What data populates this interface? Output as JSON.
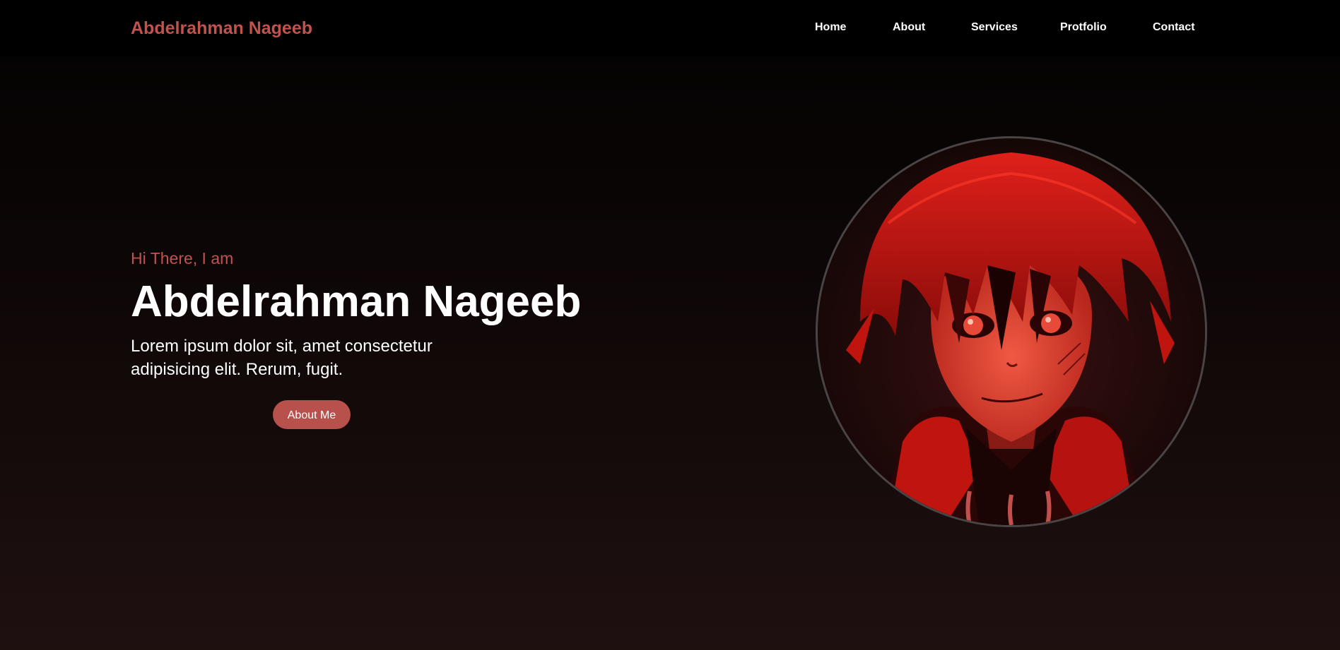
{
  "nav": {
    "brand": "Abdelrahman Nageeb",
    "links": [
      "Home",
      "About",
      "Services",
      "Protfolio",
      "Contact"
    ]
  },
  "hero": {
    "greeting": "Hi There, I am",
    "name": "Abdelrahman Nageeb",
    "description": "Lorem ipsum dolor sit, amet consectetur adipisicing elit. Rerum, fugit.",
    "button_label": "About Me"
  },
  "colors": {
    "accent": "#c2524e",
    "button": "#b8504c",
    "background_top": "#000000",
    "background_bottom": "#1f1010"
  }
}
